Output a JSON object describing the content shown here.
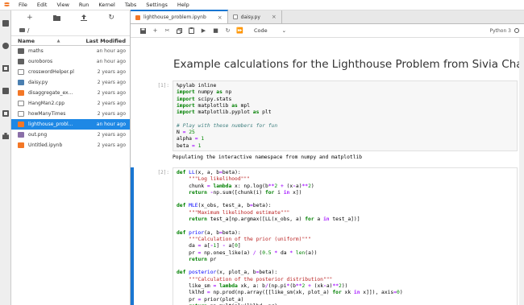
{
  "menu": [
    "File",
    "Edit",
    "View",
    "Run",
    "Kernel",
    "Tabs",
    "Settings",
    "Help"
  ],
  "browser": {
    "toolbar": [
      "+",
      "new-folder",
      "upload",
      "refresh"
    ],
    "breadcrumb": "/",
    "header": {
      "name": "Name",
      "modified": "Last Modified"
    },
    "files": [
      {
        "name": "maths",
        "modified": "an hour ago",
        "type": "folder"
      },
      {
        "name": "ouroboros",
        "modified": "an hour ago",
        "type": "folder"
      },
      {
        "name": "crosswordHelper.pl",
        "modified": "2 years ago",
        "type": "file"
      },
      {
        "name": "daisy.py",
        "modified": "2 years ago",
        "type": "py"
      },
      {
        "name": "disaggregate_ex...",
        "modified": "2 years ago",
        "type": "nb"
      },
      {
        "name": "HangMan2.cpp",
        "modified": "2 years ago",
        "type": "file"
      },
      {
        "name": "howManyTimes",
        "modified": "2 years ago",
        "type": "file"
      },
      {
        "name": "lighthouse_probl...",
        "modified": "an hour ago",
        "type": "nb",
        "selected": true
      },
      {
        "name": "out.png",
        "modified": "2 years ago",
        "type": "img"
      },
      {
        "name": "Untitled.ipynb",
        "modified": "2 years ago",
        "type": "nb"
      }
    ]
  },
  "tabs": [
    {
      "label": "lighthouse_problem.ipynb",
      "active": true
    },
    {
      "label": "daisy.py",
      "active": false
    }
  ],
  "nb_toolbar": {
    "cell_type": "Code",
    "kernel": "Python 3"
  },
  "notebook": {
    "title": "Example calculations for the Lighthouse Problem from Sivia Chapter 3",
    "cell1_prompt": "[1]:",
    "cell1_output": "Populating the interactive namespace from numpy and matplotlib",
    "cell2_prompt": "[2]:"
  },
  "colors": {
    "accent": "#1976d2",
    "selected": "#1e88e5",
    "logo": "#f37726"
  }
}
